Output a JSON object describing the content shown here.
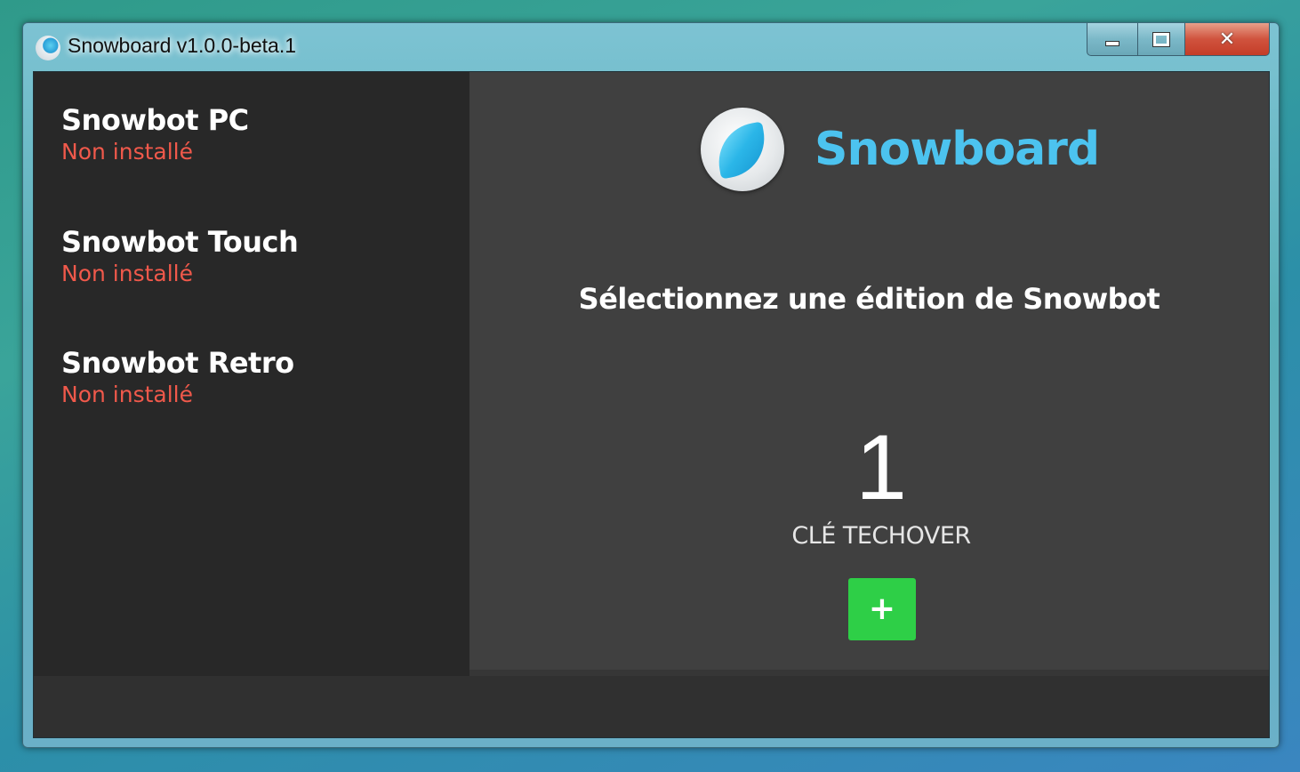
{
  "window": {
    "title": "Snowboard v1.0.0-beta.1",
    "controls": {
      "minimize": "minimize",
      "maximize": "maximize",
      "close": "✕"
    }
  },
  "sidebar": {
    "items": [
      {
        "name": "Snowbot PC",
        "status": "Non installé"
      },
      {
        "name": "Snowbot Touch",
        "status": "Non installé"
      },
      {
        "name": "Snowbot Retro",
        "status": "Non installé"
      }
    ]
  },
  "main": {
    "brand": "Snowboard",
    "prompt": "Sélectionnez une édition de Snowbot",
    "key_count": "1",
    "key_label": "CLÉ TECHOVER",
    "add_label": "+"
  },
  "colors": {
    "accent": "#4cc3ef",
    "status_not_installed": "#f0594b",
    "add_button": "#2ecf47"
  },
  "icons": {
    "app": "snowboard-logo-icon",
    "add": "plus-icon"
  }
}
